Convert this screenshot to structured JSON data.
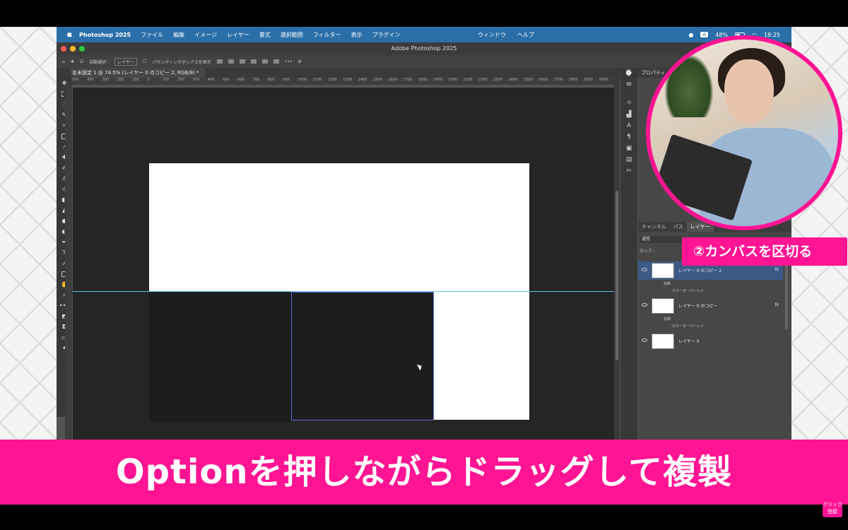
{
  "menubar": {
    "app_name": "Photoshop 2025",
    "items": [
      "ファイル",
      "編集",
      "イメージ",
      "レイヤー",
      "書式",
      "選択範囲",
      "フィルター",
      "表示",
      "プラグイン"
    ],
    "center_items": [
      "ウィンドウ",
      "ヘルプ"
    ],
    "battery": "48%",
    "time": "18:25",
    "input_badge": "A"
  },
  "window": {
    "title": "Adobe Photoshop 2025"
  },
  "options_bar": {
    "auto_select_label": "自動選択 :",
    "auto_select_value": "レイヤー",
    "bounding_box_label": "バウンディングボックスを表示"
  },
  "document_tab": {
    "label": "名未設定 1 @ 74.5% (レイヤー 0 のコピー 2, RGB/8) *"
  },
  "ruler": {
    "ticks": [
      "500",
      "400",
      "300",
      "200",
      "100",
      "0",
      "100",
      "200",
      "300",
      "400",
      "500",
      "600",
      "700",
      "800",
      "900",
      "1000",
      "1100",
      "1200",
      "1300",
      "1400",
      "1500",
      "1600",
      "1700",
      "1800",
      "1900",
      "2000",
      "2100",
      "2200",
      "2300",
      "2400",
      "2500",
      "2600",
      "2700",
      "2800",
      "2900",
      "3000"
    ]
  },
  "panels": {
    "properties_title": "プロパティ",
    "tabs": [
      "チャンネル",
      "パス",
      "レイヤー"
    ],
    "blend_mode": "通常",
    "lock_label": "ロック :",
    "layers": [
      {
        "name": "レイヤー 0 のコピー 2",
        "fx": "fx",
        "effects_label": "効果",
        "effect": "カラーオーバーレイ"
      },
      {
        "name": "レイヤー 0 のコピー",
        "fx": "fx",
        "effects_label": "効果",
        "effect": "カラーオーバーレイ"
      },
      {
        "name": "レイヤー 0"
      }
    ]
  },
  "overlay": {
    "step_label": "②カンバスを区切る",
    "caption": "Optionを押しながらドラッグして複製",
    "subscribe_line1": "クリック",
    "subscribe_line2": "登録"
  },
  "colors": {
    "accent_pink": "#ff1493",
    "menubar_blue": "#2a6fa8",
    "guide_cyan": "#5bc8e8",
    "selection_blue": "#5f6bd6"
  }
}
